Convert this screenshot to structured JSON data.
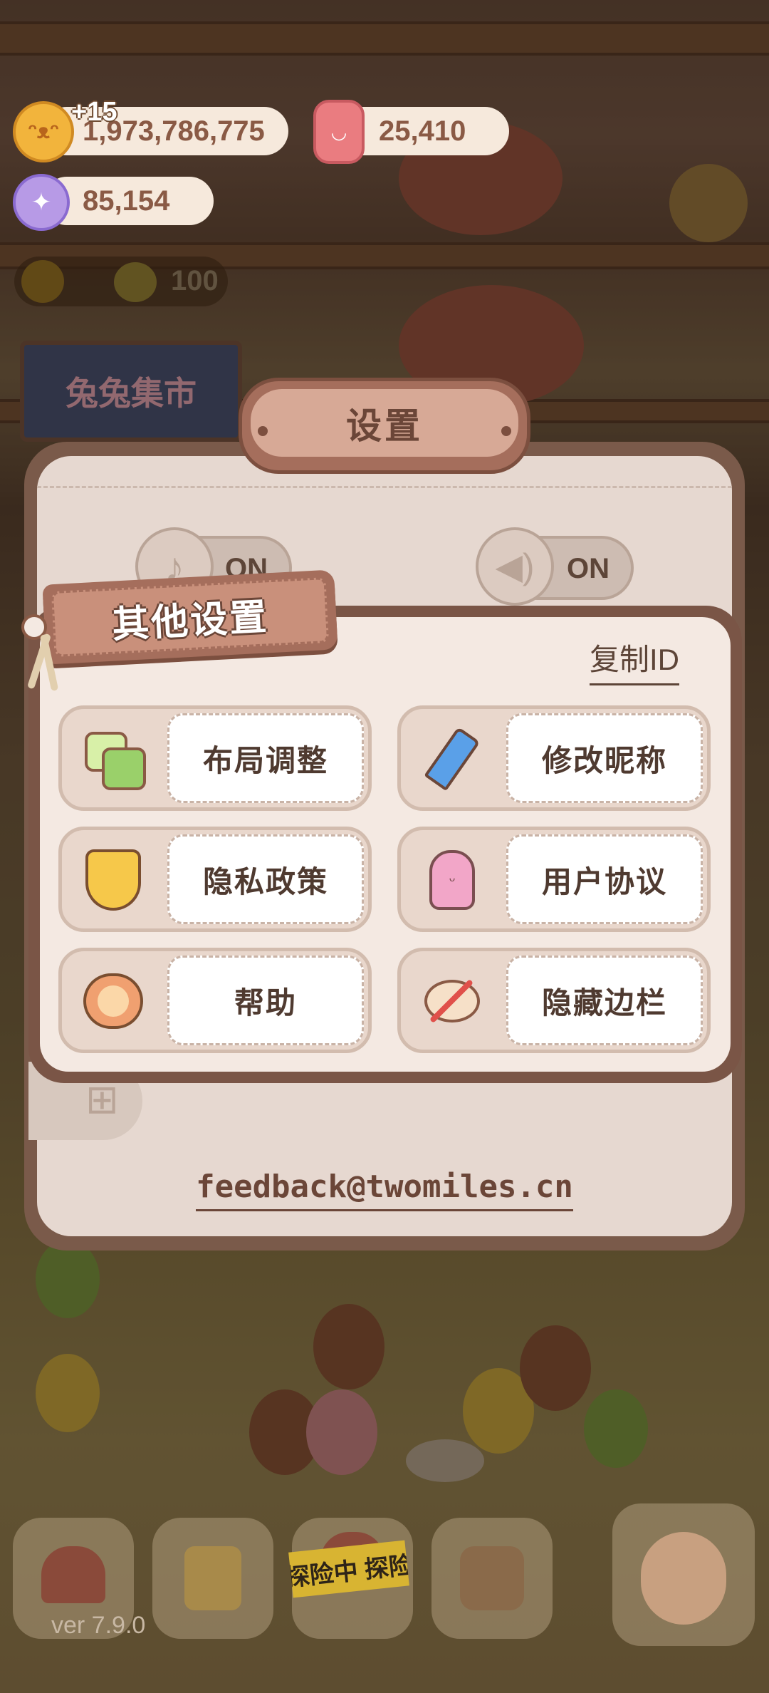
{
  "resources": {
    "coins": "1,973,786,775",
    "coins_gain": "+15",
    "candles": "25,410",
    "gems": "85,154",
    "suns": "100"
  },
  "market_sign": "兔兔集市",
  "settings": {
    "title": "设置",
    "music_toggle": "ON",
    "sound_toggle": "ON",
    "feedback_email": "feedback@twomiles.cn"
  },
  "other_settings": {
    "title": "其他设置",
    "copy_id": "复制ID",
    "buttons": [
      {
        "label": "布局调整",
        "icon": "layout-icon"
      },
      {
        "label": "修改昵称",
        "icon": "pencil-icon"
      },
      {
        "label": "隐私政策",
        "icon": "shield-icon"
      },
      {
        "label": "用户协议",
        "icon": "user-icon"
      },
      {
        "label": "帮助",
        "icon": "headset-icon"
      },
      {
        "label": "隐藏边栏",
        "icon": "hide-sidebar-icon"
      }
    ]
  },
  "bottom_bar": {
    "explore_banner": "探险中 探险",
    "version": "ver 7.9.0"
  },
  "colors": {
    "panel_border": "#7a5a4a",
    "panel_bg": "#e6d8d0",
    "card_bg": "#f4e9e2",
    "title_plate": "#a56e5c",
    "text_dark": "#4f3a30"
  }
}
